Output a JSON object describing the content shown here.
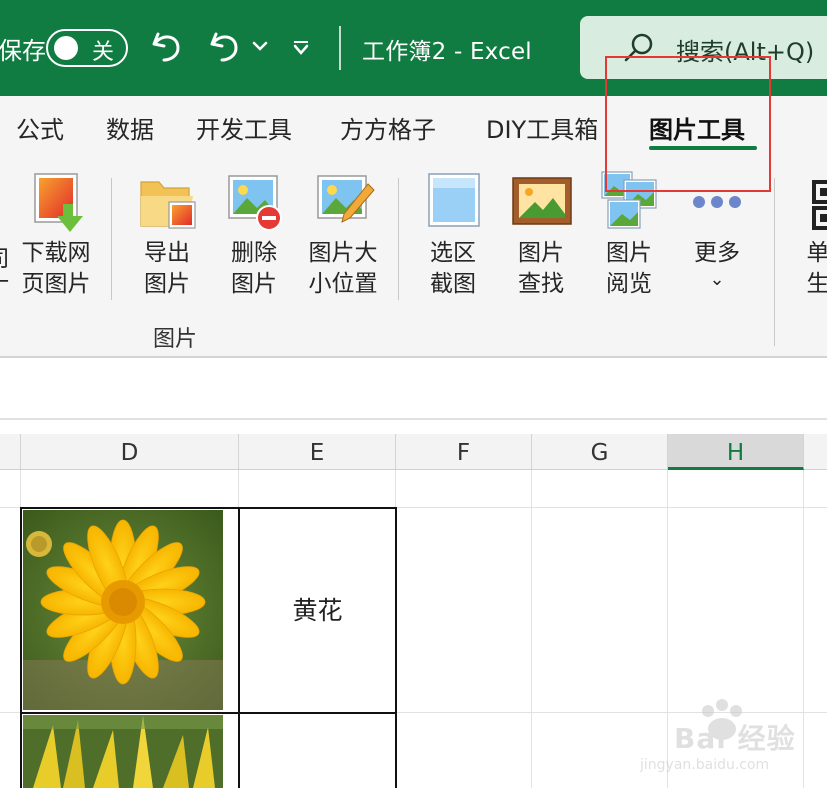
{
  "titlebar": {
    "autosave_label": "保存",
    "autosave_state": "关",
    "window_title": "工作簿2  -  Excel",
    "search_placeholder": "搜索(Alt+Q)"
  },
  "tabs": [
    {
      "label": "公式"
    },
    {
      "label": "数据"
    },
    {
      "label": "开发工具"
    },
    {
      "label": "方方格子"
    },
    {
      "label": "DIY工具箱"
    },
    {
      "label": "图片工具",
      "active": true
    }
  ],
  "ribbon": {
    "group_label": "图片",
    "buttons": [
      {
        "line1": "司",
        "line2": "丁"
      },
      {
        "line1": "下载网",
        "line2": "页图片"
      },
      {
        "line1": "导出",
        "line2": "图片"
      },
      {
        "line1": "删除",
        "line2": "图片"
      },
      {
        "line1": "图片大",
        "line2": "小位置"
      },
      {
        "line1": "选区",
        "line2": "截图"
      },
      {
        "line1": "图片",
        "line2": "查找"
      },
      {
        "line1": "图片",
        "line2": "阅览"
      },
      {
        "line1": "更多",
        "line2": "⌄"
      },
      {
        "line1": "单",
        "line2": "生"
      }
    ]
  },
  "columns": [
    {
      "label": "D"
    },
    {
      "label": "E"
    },
    {
      "label": "F"
    },
    {
      "label": "G"
    },
    {
      "label": "H",
      "selected": true
    }
  ],
  "cells": {
    "e2": "黄花"
  },
  "watermark": {
    "text": "Bai 经验",
    "url": "jingyan.baidu.com"
  },
  "colors": {
    "excel_green": "#107c41",
    "highlight_red": "#e53935"
  }
}
